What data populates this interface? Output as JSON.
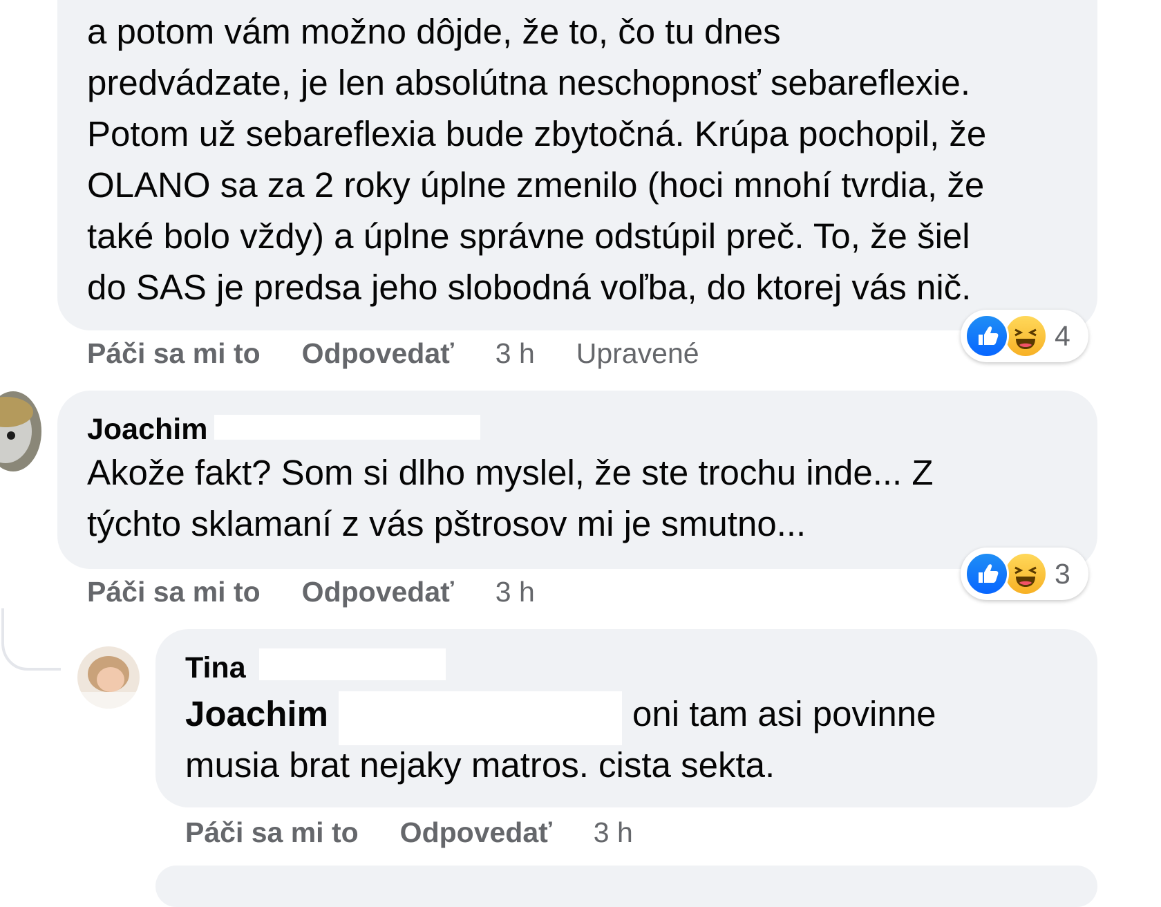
{
  "comment1": {
    "lines": [
      "a potom vám možno dôjde, že to, čo tu dnes",
      "predvádzate, je len absolútna neschopnosť sebareflexie.",
      "Potom už sebareflexia bude zbytočná. Krúpa pochopil, že",
      "OLANO sa za 2 roky úplne zmenilo (hoci mnohí tvrdia, že",
      "také bolo vždy) a úplne správne odstúpil preč. To, že šiel",
      "do SAS je predsa jeho slobodná voľba, do ktorej vás nič."
    ],
    "reaction_count": "4",
    "like_label": "Páči sa mi to",
    "reply_label": "Odpovedať",
    "time": "3 h",
    "edited": "Upravené"
  },
  "comment2": {
    "author": "Joachim",
    "lines": [
      "Akože fakt? Som si dlho myslel, že ste trochu inde... Z",
      "týchto sklamaní z vás pštrosov mi je smutno..."
    ],
    "reaction_count": "3",
    "like_label": "Páči sa mi to",
    "reply_label": "Odpovedať",
    "time": "3 h"
  },
  "comment3": {
    "author": "Tina",
    "mention": "Joachim",
    "line1_rest": "oni tam asi povinne",
    "line2": "musia brat nejaky matros. cista sekta.",
    "like_label": "Páči sa mi to",
    "reply_label": "Odpovedať",
    "time": "3 h"
  },
  "colors": {
    "bubble": "#f0f2f5",
    "secondary_text": "#65676b",
    "like_blue": "#0866ff",
    "haha_yellow": "#f7b125"
  }
}
